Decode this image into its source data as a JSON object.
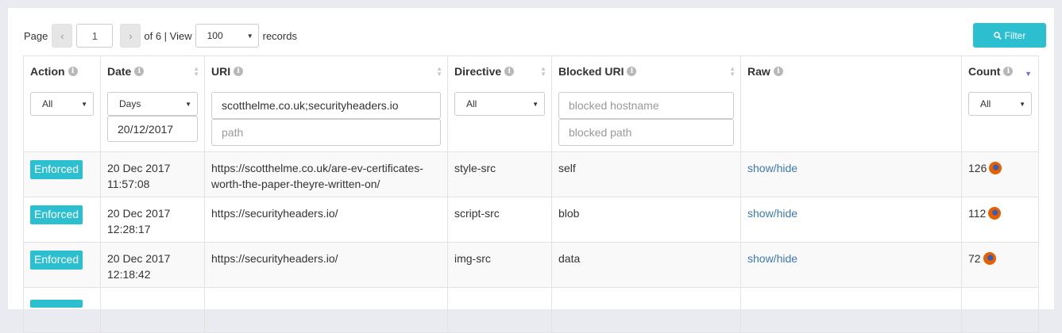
{
  "toolbar": {
    "page_label": "Page",
    "prev_icon": "chevron-left-icon",
    "prev_glyph": "‹",
    "current_page": "1",
    "next_icon": "chevron-right-icon",
    "next_glyph": "›",
    "of_label": "of 6 | View",
    "view_value": "100",
    "records_label": "records",
    "filter_label": "Filter",
    "filter_icon": "search-icon"
  },
  "columns": [
    {
      "label": "Action"
    },
    {
      "label": "Date"
    },
    {
      "label": "URI"
    },
    {
      "label": "Directive"
    },
    {
      "label": "Blocked URI"
    },
    {
      "label": "Raw"
    },
    {
      "label": "Count"
    }
  ],
  "filters": {
    "action": "All",
    "date_range": "Days",
    "date_value": "20/12/2017",
    "uri_host": "scotthelme.co.uk;securityheaders.io",
    "uri_path_placeholder": "path",
    "directive": "All",
    "blocked_host_placeholder": "blocked hostname",
    "blocked_path_placeholder": "blocked path",
    "count": "All"
  },
  "rows": [
    {
      "action": "Enforced",
      "date": "20 Dec 2017",
      "time": "11:57:08",
      "uri": "https://scotthelme.co.uk/are-ev-certificates-worth-the-paper-theyre-written-on/",
      "directive": "style-src",
      "blocked_uri": "self",
      "raw": "show/hide",
      "count": "126"
    },
    {
      "action": "Enforced",
      "date": "20 Dec 2017",
      "time": "12:28:17",
      "uri": "https://securityheaders.io/",
      "directive": "script-src",
      "blocked_uri": "blob",
      "raw": "show/hide",
      "count": "112"
    },
    {
      "action": "Enforced",
      "date": "20 Dec 2017",
      "time": "12:18:42",
      "uri": "https://securityheaders.io/",
      "directive": "img-src",
      "blocked_uri": "data",
      "raw": "show/hide",
      "count": "72"
    },
    {
      "action": "",
      "date": "",
      "time": "",
      "uri": "",
      "directive": "",
      "blocked_uri": "",
      "raw": "",
      "count": ""
    }
  ],
  "colors": {
    "accent": "#2bbfd0",
    "link": "#3d78b6",
    "sort_active": "#6b6fd6"
  }
}
